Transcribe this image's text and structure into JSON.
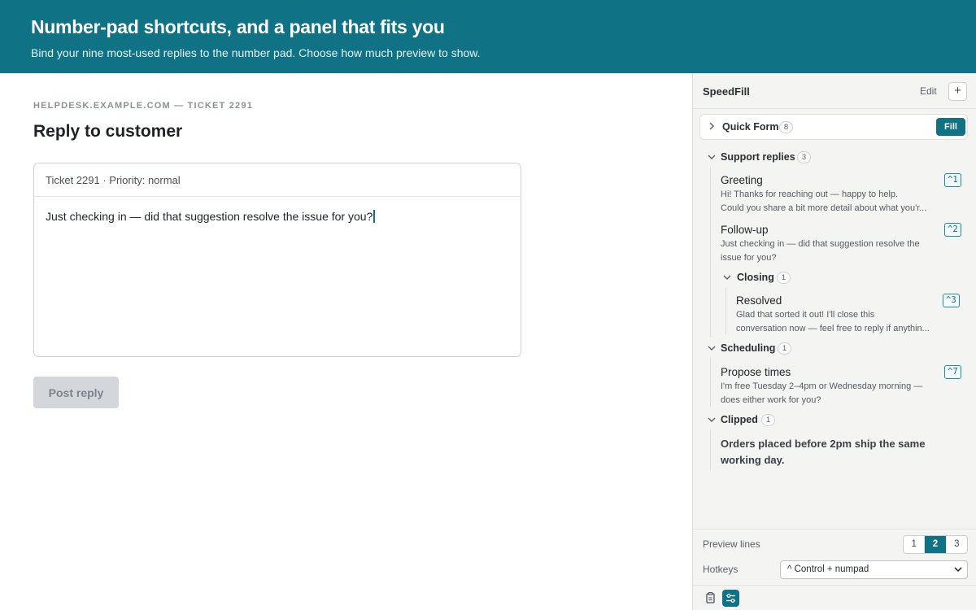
{
  "banner": {
    "title": "Number-pad shortcuts, and a panel that fits you",
    "subtitle": "Bind your nine most-used replies to the number pad. Choose how much preview to show."
  },
  "main": {
    "breadcrumb": "HELPDESK.EXAMPLE.COM — TICKET 2291",
    "title": "Reply to customer",
    "editor": {
      "header": "Ticket 2291 · Priority: normal",
      "body": "Just checking in — did that suggestion resolve the issue for you?"
    },
    "post_button": "Post reply"
  },
  "panel": {
    "name": "SpeedFill",
    "edit_label": "Edit",
    "add_label": "+",
    "quick_form": {
      "label": "Quick Form",
      "count": "8",
      "fill_label": "Fill"
    },
    "groups": {
      "support": {
        "label": "Support replies",
        "count": "3"
      },
      "closing": {
        "label": "Closing",
        "count": "1"
      },
      "scheduling": {
        "label": "Scheduling",
        "count": "1"
      },
      "clipped": {
        "label": "Clipped",
        "count": "1"
      }
    },
    "snippets": {
      "greeting": {
        "title": "Greeting",
        "hotkey": "^1",
        "preview": [
          "Hi! Thanks for reaching out — happy to help.",
          "Could you share a bit more detail about what you'r..."
        ]
      },
      "followup": {
        "title": "Follow-up",
        "hotkey": "^2",
        "preview": [
          "Just checking in — did that suggestion resolve the",
          "issue for you?"
        ]
      },
      "resolved": {
        "title": "Resolved",
        "hotkey": "^3",
        "preview": [
          "Glad that sorted it out! I'll close this",
          "conversation now — feel free to reply if anythin..."
        ]
      },
      "propose": {
        "title": "Propose times",
        "hotkey": "^7",
        "preview": [
          "I'm free Tuesday 2–4pm or Wednesday morning —",
          "does either work for you?"
        ]
      }
    },
    "clipped_text": "Orders placed before 2pm ship the same working day.",
    "footer": {
      "preview_label": "Preview lines",
      "preview_options": [
        "1",
        "2",
        "3"
      ],
      "preview_selected": "2",
      "hotkeys_label": "Hotkeys",
      "hotkeys_value": "^ Control + numpad"
    },
    "icons": {
      "left": "clipboard-icon",
      "right": "sliders-icon"
    }
  },
  "colors": {
    "accent": "#0f7285",
    "panel_bg": "#f4f4f2",
    "disabled_button": "#d3d7db"
  }
}
